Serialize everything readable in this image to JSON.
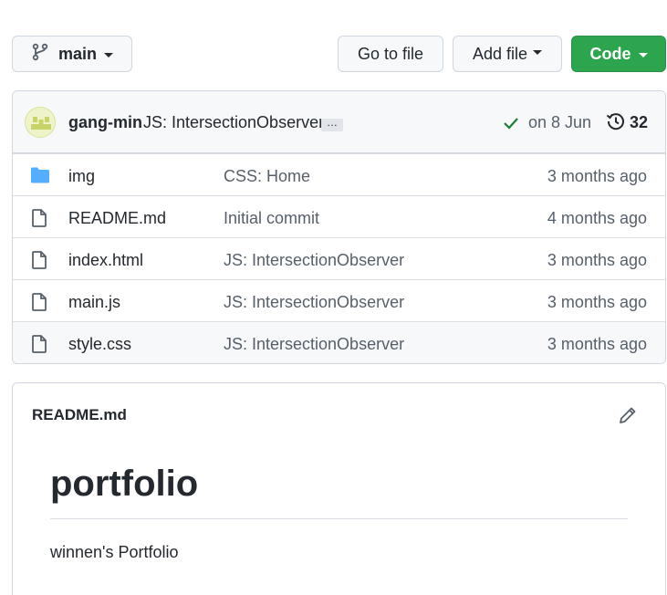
{
  "branch": {
    "label": "main"
  },
  "buttons": {
    "goto": "Go to file",
    "add": "Add file",
    "code": "Code"
  },
  "commit": {
    "author": "gang-min",
    "message": "JS: IntersectionObserver",
    "more": "…",
    "date": "on 8 Jun",
    "count": "32"
  },
  "files": [
    {
      "name": "img",
      "message": "CSS: Home",
      "time": "3 months ago",
      "type": "folder"
    },
    {
      "name": "README.md",
      "message": "Initial commit",
      "time": "4 months ago",
      "type": "file"
    },
    {
      "name": "index.html",
      "message": "JS: IntersectionObserver",
      "time": "3 months ago",
      "type": "file"
    },
    {
      "name": "main.js",
      "message": "JS: IntersectionObserver",
      "time": "3 months ago",
      "type": "file"
    },
    {
      "name": "style.css",
      "message": "JS: IntersectionObserver",
      "time": "3 months ago",
      "type": "file"
    }
  ],
  "readme": {
    "filename": "README.md",
    "heading": "portfolio",
    "text": "winnen's Portfolio"
  },
  "colors": {
    "accent_green": "#2da44e",
    "folder_blue": "#54aeff",
    "check_green": "#1a7f37"
  },
  "icons": [
    "git-branch-icon",
    "check-icon",
    "history-icon",
    "folder-icon",
    "file-icon",
    "pencil-icon"
  ]
}
